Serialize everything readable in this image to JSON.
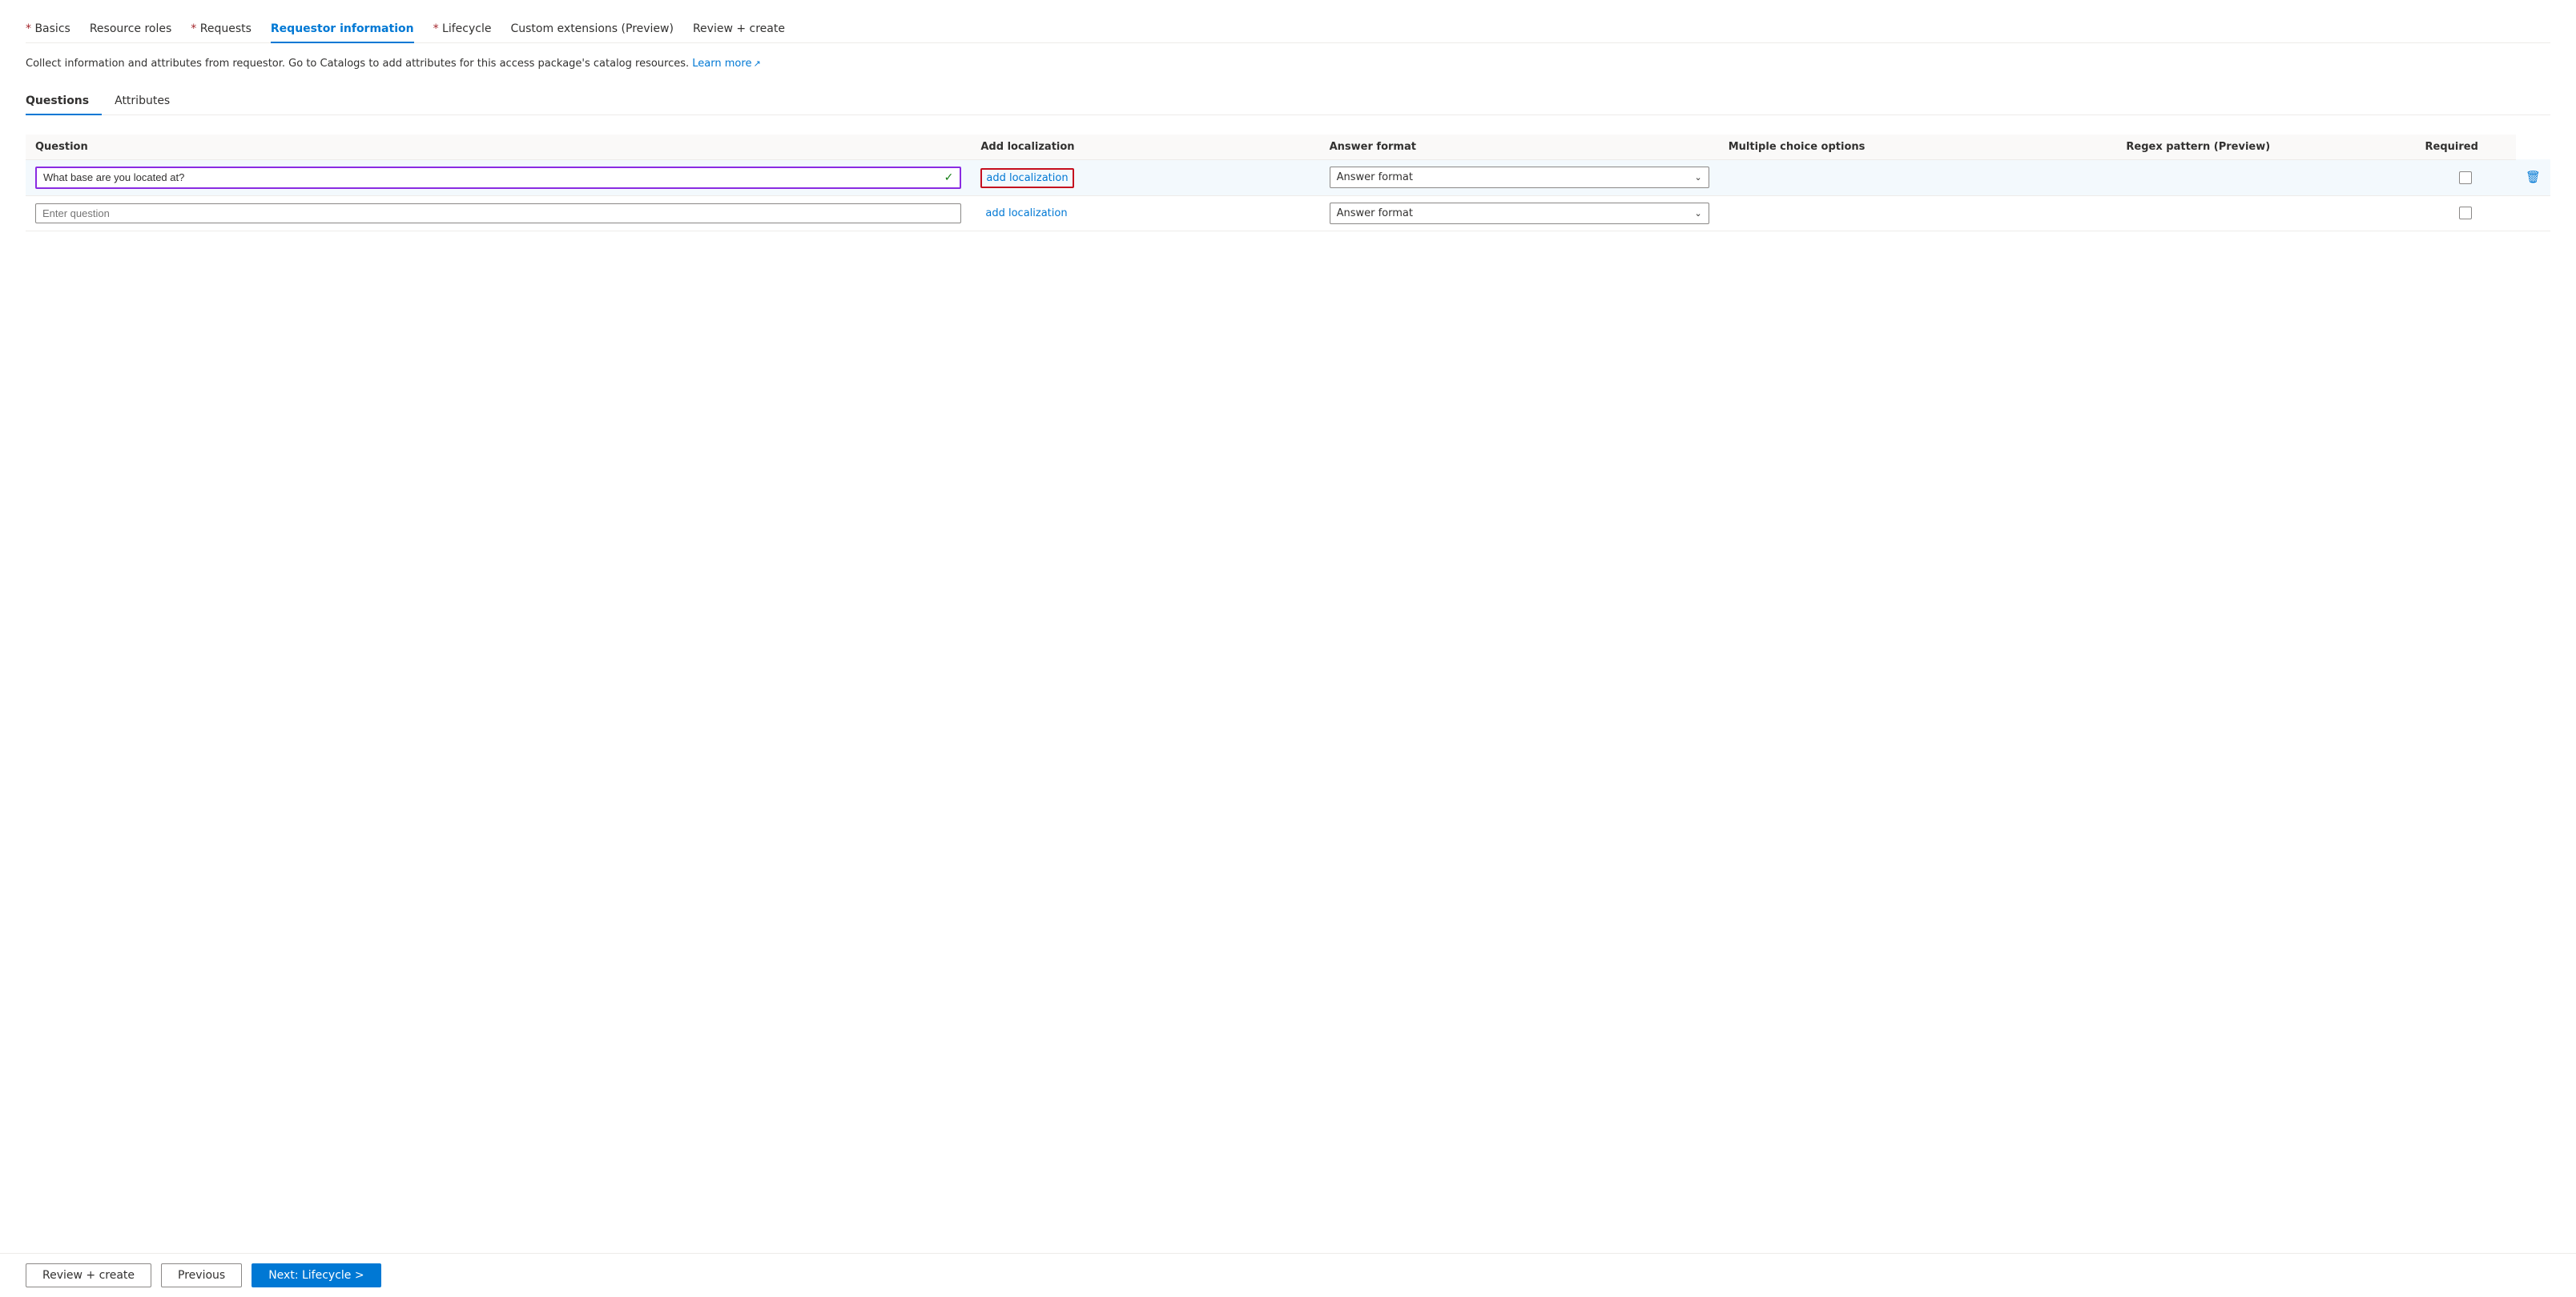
{
  "nav": {
    "tabs": [
      {
        "label": "Basics",
        "required": true,
        "active": false
      },
      {
        "label": "Resource roles",
        "required": false,
        "active": false
      },
      {
        "label": "Requests",
        "required": true,
        "active": false
      },
      {
        "label": "Requestor information",
        "required": false,
        "active": true
      },
      {
        "label": "Lifecycle",
        "required": true,
        "active": false
      },
      {
        "label": "Custom extensions (Preview)",
        "required": false,
        "active": false
      },
      {
        "label": "Review + create",
        "required": false,
        "active": false
      }
    ]
  },
  "description": {
    "text": "Collect information and attributes from requestor. Go to Catalogs to add attributes for this access package's catalog resources.",
    "link_text": "Learn more",
    "link_icon": "↗"
  },
  "sub_tabs": [
    {
      "label": "Questions",
      "active": true
    },
    {
      "label": "Attributes",
      "active": false
    }
  ],
  "table": {
    "headers": [
      {
        "label": "Question"
      },
      {
        "label": "Add localization"
      },
      {
        "label": "Answer format"
      },
      {
        "label": "Multiple choice options"
      },
      {
        "label": "Regex pattern (Preview)"
      },
      {
        "label": "Required"
      }
    ],
    "rows": [
      {
        "question_value": "What base are you located at?",
        "has_check": true,
        "localization_label": "add localization",
        "localization_highlighted": true,
        "answer_format": "Answer format",
        "required_checked": false,
        "has_delete": true
      },
      {
        "question_value": "",
        "question_placeholder": "Enter question",
        "has_check": false,
        "localization_label": "add localization",
        "localization_highlighted": false,
        "answer_format": "Answer format",
        "required_checked": false,
        "has_delete": false
      }
    ]
  },
  "footer": {
    "review_create_label": "Review + create",
    "previous_label": "Previous",
    "next_label": "Next: Lifecycle >"
  }
}
